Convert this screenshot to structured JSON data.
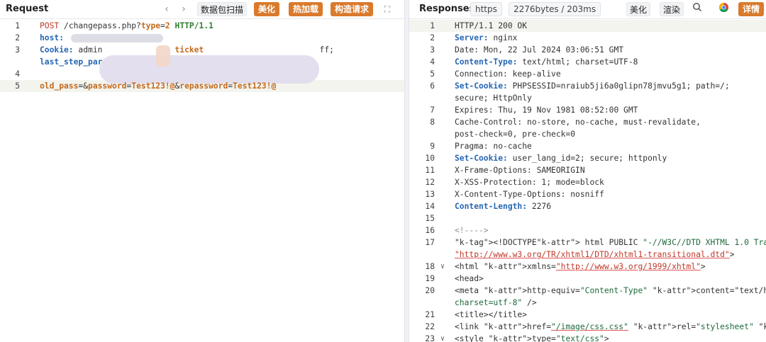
{
  "request": {
    "title": "Request",
    "tool_scan": "数据包扫描",
    "btn_beautify": "美化",
    "btn_hot_load": "热加载",
    "btn_construct": "构造请求",
    "lines": [
      {
        "n": "1",
        "method": "POST",
        "path": "/changepass.php?",
        "param": "type",
        "eq": "=",
        "val": "2",
        "proto": "HTTP/1.1"
      },
      {
        "n": "2",
        "key": "host:"
      },
      {
        "n": "3",
        "key": "Cookie:",
        "rest_a": "admin",
        "rest_b": "ticket",
        "rest_c": "ff;",
        "cont": "last_step_par"
      },
      {
        "n": "4"
      },
      {
        "n": "5",
        "p1": "old_pass",
        "eq1": "=&",
        "p2": "password",
        "eq2": "=",
        "v2": "Test123!@",
        "amp": "&",
        "p3": "repassword",
        "eq3": "=",
        "v3": "Test123!@"
      }
    ]
  },
  "response": {
    "title": "Responses",
    "scheme": "https",
    "stats": "2276bytes / 203ms",
    "btn_beautify": "美化",
    "btn_render": "渲染",
    "btn_detail": "详情",
    "lines": [
      {
        "n": "1",
        "t": "HTTP/1.1 200 OK",
        "kind": "status"
      },
      {
        "n": "2",
        "k": "Server:",
        "v": " nginx",
        "kind": "hdr-bold"
      },
      {
        "n": "3",
        "k": "Date:",
        "v": " Mon, 22 Jul 2024 03:06:51 GMT",
        "kind": "hdr"
      },
      {
        "n": "4",
        "k": "Content-Type:",
        "v": " text/html; charset=UTF-8",
        "kind": "hdr-bold"
      },
      {
        "n": "5",
        "k": "Connection:",
        "v": " keep-alive",
        "kind": "hdr"
      },
      {
        "n": "6",
        "k": "Set-Cookie:",
        "v": " PHPSESSID=nraiub5ji6a0glipn78jmvu5g1; path=/;",
        "kind": "hdr-bold"
      },
      {
        "n": "",
        "t": "secure; HttpOnly",
        "kind": "cont"
      },
      {
        "n": "7",
        "k": "Expires:",
        "v": " Thu, 19 Nov 1981 08:52:00 GMT",
        "kind": "hdr"
      },
      {
        "n": "8",
        "k": "Cache-Control:",
        "v": " no-store, no-cache, must-revalidate,",
        "kind": "hdr"
      },
      {
        "n": "",
        "t": "post-check=0, pre-check=0",
        "kind": "cont"
      },
      {
        "n": "9",
        "k": "Pragma:",
        "v": " no-cache",
        "kind": "hdr"
      },
      {
        "n": "10",
        "k": "Set-Cookie:",
        "v": " user_lang_id=2; secure; httponly",
        "kind": "hdr-bold"
      },
      {
        "n": "11",
        "k": "X-Frame-Options:",
        "v": " SAMEORIGIN",
        "kind": "hdr"
      },
      {
        "n": "12",
        "k": "X-XSS-Protection:",
        "v": " 1; mode=block",
        "kind": "hdr"
      },
      {
        "n": "13",
        "k": "X-Content-Type-Options:",
        "v": " nosniff",
        "kind": "hdr"
      },
      {
        "n": "14",
        "k": "Content-Length:",
        "v": " 2276",
        "kind": "hdr-bold"
      },
      {
        "n": "15",
        "t": "",
        "kind": "blank"
      },
      {
        "n": "16",
        "t": "<!---->",
        "kind": "comment"
      },
      {
        "n": "17",
        "t": "<!DOCTYPE html PUBLIC \"-//W3C//DTD XHTML 1.0 Transitional//EN\"",
        "kind": "doctype"
      },
      {
        "n": "",
        "t": "\"http://www.w3.org/TR/xhtml1/DTD/xhtml1-transitional.dtd\">",
        "kind": "doctype-url"
      },
      {
        "n": "18",
        "t": "<html xmlns=\"http://www.w3.org/1999/xhtml\">",
        "kind": "html",
        "fold": true
      },
      {
        "n": "19",
        "t": "<head>",
        "kind": "tag"
      },
      {
        "n": "20",
        "t": "<meta http-equiv=\"Content-Type\" content=\"text/html;",
        "kind": "meta"
      },
      {
        "n": "",
        "t": "charset=utf-8\" />",
        "kind": "meta-cont"
      },
      {
        "n": "21",
        "t": "<title></title>",
        "kind": "tag"
      },
      {
        "n": "22",
        "t": "<link href=\"/image/css.css\" rel=\"stylesheet\" type=\"text/css\" />",
        "kind": "link"
      },
      {
        "n": "23",
        "t": "<style type=\"text/css\">",
        "kind": "style",
        "fold": true
      }
    ]
  }
}
